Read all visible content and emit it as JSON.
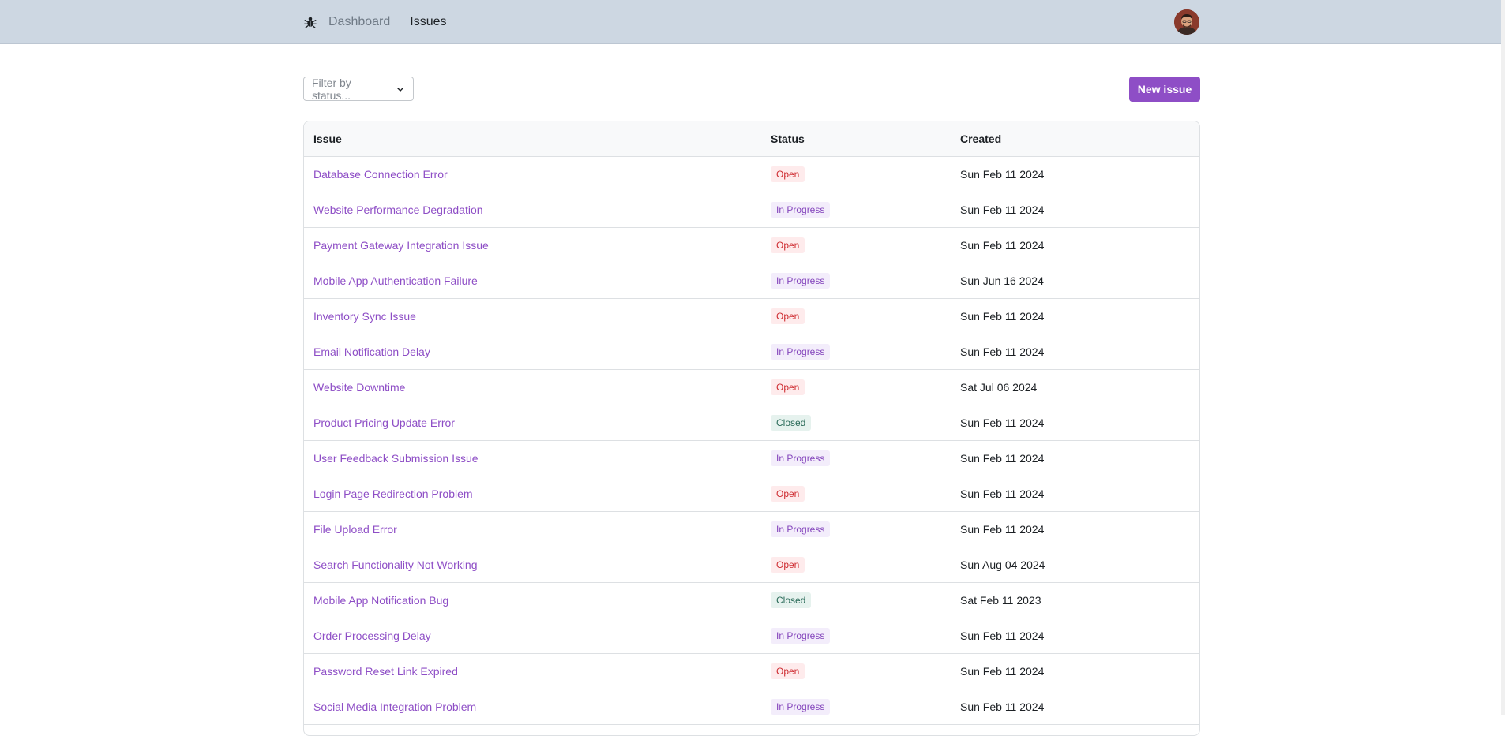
{
  "nav": {
    "logo_icon": "bug-icon",
    "links": [
      "Dashboard",
      "Issues"
    ],
    "active": "Issues"
  },
  "toolbar": {
    "filter_placeholder": "Filter by status...",
    "new_issue_label": "New issue"
  },
  "table": {
    "headers": [
      "Issue",
      "Status",
      "Created"
    ],
    "rows": [
      {
        "title": "Database Connection Error",
        "status": "Open",
        "created": "Sun Feb 11 2024"
      },
      {
        "title": "Website Performance Degradation",
        "status": "In Progress",
        "created": "Sun Feb 11 2024"
      },
      {
        "title": "Payment Gateway Integration Issue",
        "status": "Open",
        "created": "Sun Feb 11 2024"
      },
      {
        "title": "Mobile App Authentication Failure",
        "status": "In Progress",
        "created": "Sun Jun 16 2024"
      },
      {
        "title": "Inventory Sync Issue",
        "status": "Open",
        "created": "Sun Feb 11 2024"
      },
      {
        "title": "Email Notification Delay",
        "status": "In Progress",
        "created": "Sun Feb 11 2024"
      },
      {
        "title": "Website Downtime",
        "status": "Open",
        "created": "Sat Jul 06 2024"
      },
      {
        "title": "Product Pricing Update Error",
        "status": "Closed",
        "created": "Sun Feb 11 2024"
      },
      {
        "title": "User Feedback Submission Issue",
        "status": "In Progress",
        "created": "Sun Feb 11 2024"
      },
      {
        "title": "Login Page Redirection Problem",
        "status": "Open",
        "created": "Sun Feb 11 2024"
      },
      {
        "title": "File Upload Error",
        "status": "In Progress",
        "created": "Sun Feb 11 2024"
      },
      {
        "title": "Search Functionality Not Working",
        "status": "Open",
        "created": "Sun Aug 04 2024"
      },
      {
        "title": "Mobile App Notification Bug",
        "status": "Closed",
        "created": "Sat Feb 11 2023"
      },
      {
        "title": "Order Processing Delay",
        "status": "In Progress",
        "created": "Sun Feb 11 2024"
      },
      {
        "title": "Password Reset Link Expired",
        "status": "Open",
        "created": "Sun Feb 11 2024"
      },
      {
        "title": "Social Media Integration Problem",
        "status": "In Progress",
        "created": "Sun Feb 11 2024"
      }
    ]
  },
  "colors": {
    "accent": "#8e4ec6",
    "topbar": "#cdd7e2",
    "open": "#ce2c31",
    "in_progress": "#8445bc",
    "closed": "#2b6b59"
  }
}
